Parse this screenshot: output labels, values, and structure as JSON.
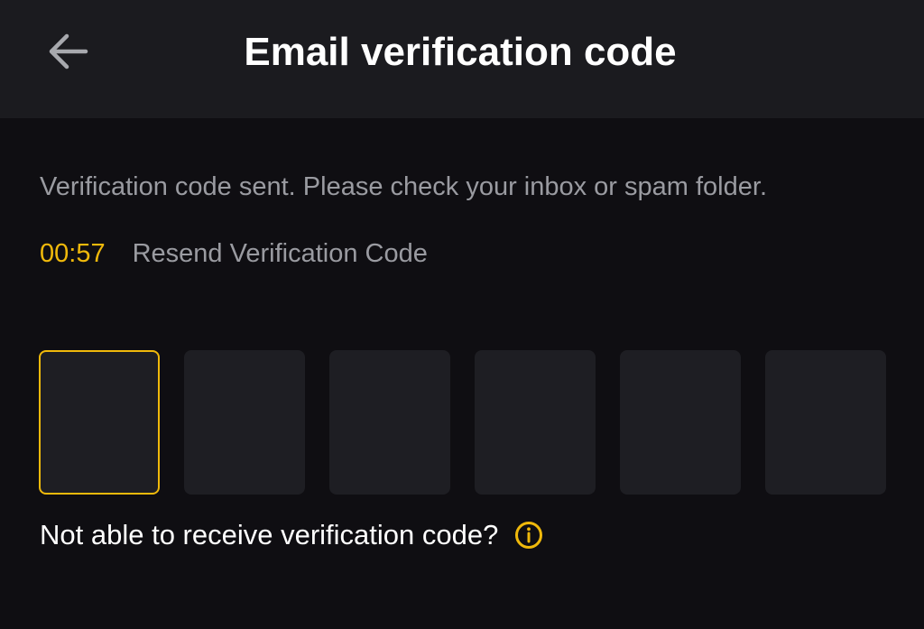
{
  "header": {
    "title": "Email verification code",
    "back_icon": "arrow-left-icon"
  },
  "main": {
    "subtitle": "Verification code sent. Please check your inbox or spam folder.",
    "countdown": "00:57",
    "resend_label": "Resend Verification Code",
    "code_length": 6,
    "active_box_index": 0,
    "help_text": "Not able to receive verification code?",
    "help_icon": "info-icon"
  },
  "colors": {
    "background": "#0f0e12",
    "header_background": "#1b1b1f",
    "accent": "#f0b90b",
    "box_background": "#1e1e23",
    "muted_text": "#9a9ba1",
    "primary_text": "#ffffff"
  }
}
